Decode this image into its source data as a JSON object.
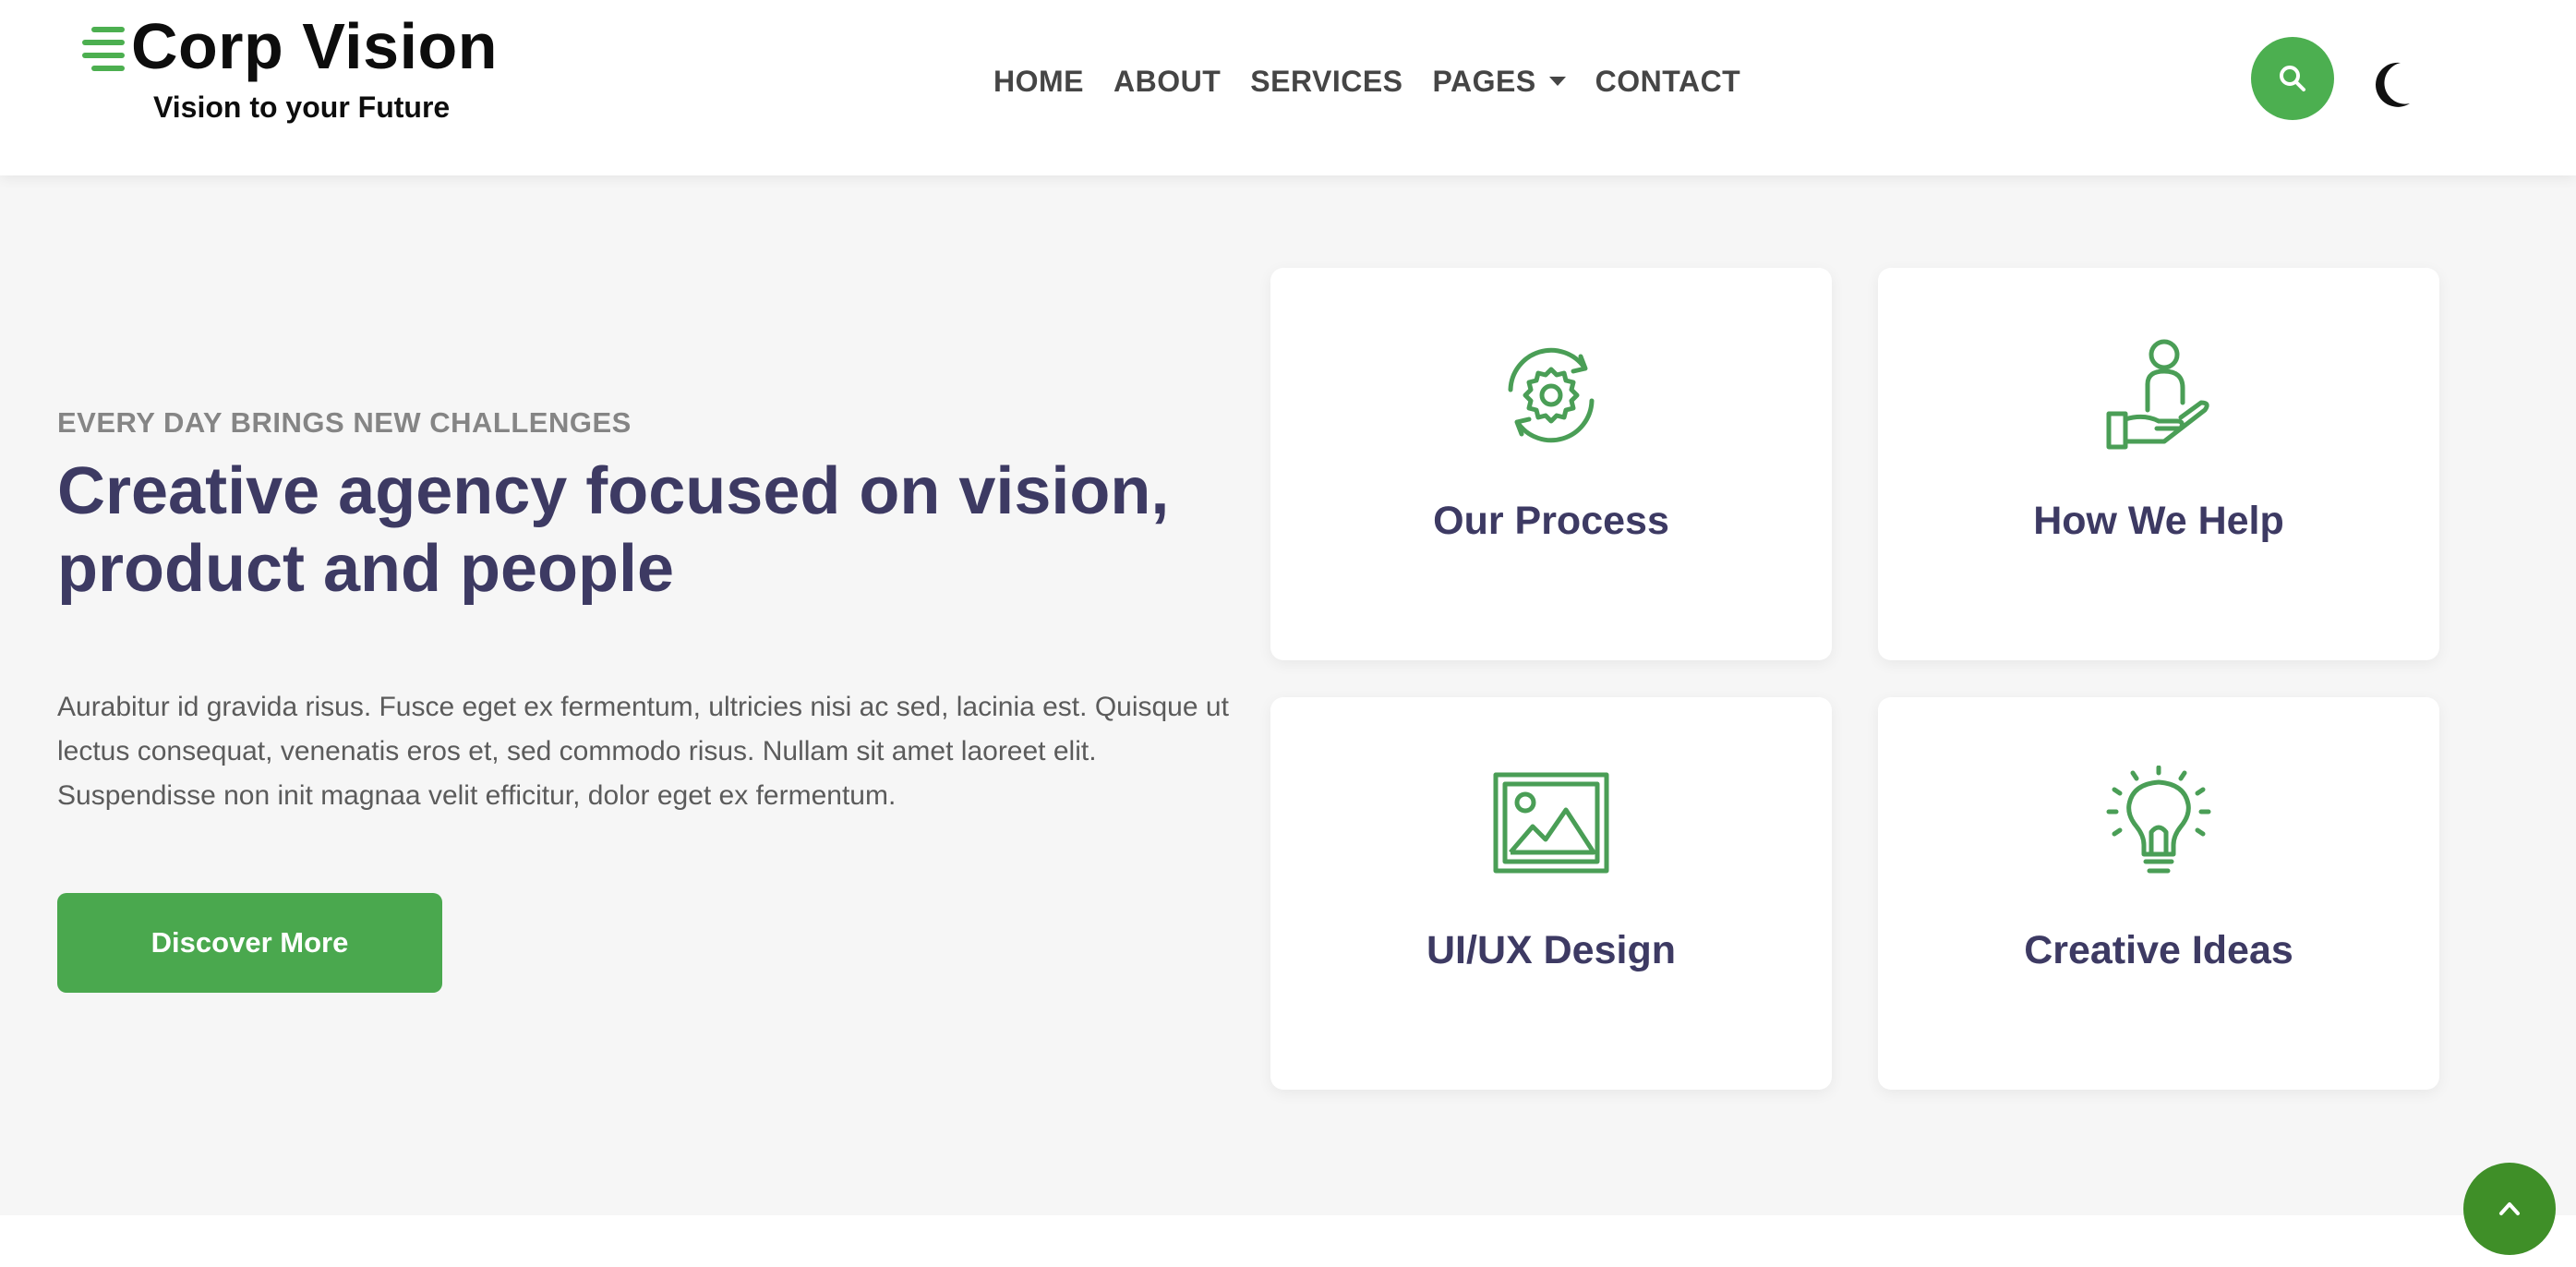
{
  "brand": {
    "name": "Corp Vision",
    "tagline": "Vision to your Future",
    "accent_color": "#4caf50",
    "heading_color": "#3d3a63"
  },
  "nav": {
    "items": [
      {
        "label": "HOME"
      },
      {
        "label": "ABOUT"
      },
      {
        "label": "SERVICES"
      },
      {
        "label": "PAGES",
        "has_dropdown": true
      },
      {
        "label": "CONTACT"
      }
    ],
    "search_icon": "search-icon",
    "theme_toggle_icon": "moon-icon"
  },
  "hero": {
    "eyebrow": "EVERY DAY BRINGS NEW CHALLENGES",
    "headline": "Creative agency focused on vision, product and people",
    "body": "Aurabitur id gravida risus. Fusce eget ex fermentum, ultricies nisi ac sed, lacinia est. Quisque ut lectus consequat, venenatis eros et, sed commodo risus. Nullam sit amet laoreet elit. Suspendisse non init magnaa velit efficitur, dolor eget ex fermentum.",
    "cta_label": "Discover More"
  },
  "features": [
    {
      "title": "Our Process",
      "icon": "gear-cycle-icon"
    },
    {
      "title": "How We Help",
      "icon": "person-hand-icon"
    },
    {
      "title": "UI/UX Design",
      "icon": "image-icon"
    },
    {
      "title": "Creative Ideas",
      "icon": "lightbulb-icon"
    }
  ],
  "scroll_top_icon": "chevron-up-icon"
}
